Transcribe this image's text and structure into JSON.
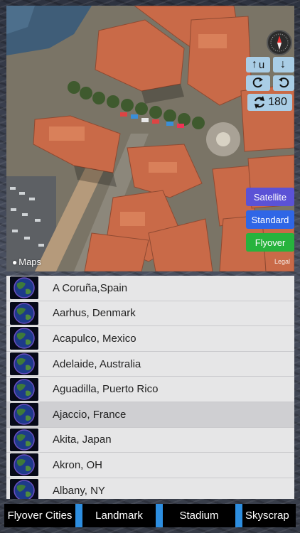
{
  "map": {
    "logo_text": "Maps",
    "legal_text": "Legal",
    "compass_icon": "compass-icon",
    "controls": {
      "tilt_up_label": "u",
      "tilt_down_label": "",
      "rotate_left_icon": "rotate-left-icon",
      "rotate_right_icon": "rotate-right-icon",
      "rotate_value": "180"
    },
    "view_buttons": {
      "satellite": "Satellite",
      "standard": "Standard",
      "flyover": "Flyover"
    },
    "colors": {
      "satellite": "#5b52d6",
      "standard": "#2f66e6",
      "flyover": "#27b33d",
      "control_bg": "#a9cde6"
    }
  },
  "cities": [
    {
      "name": "A Coruña,Spain",
      "selected": false
    },
    {
      "name": "Aarhus, Denmark",
      "selected": false
    },
    {
      "name": "Acapulco, Mexico",
      "selected": false
    },
    {
      "name": "Adelaide, Australia",
      "selected": false
    },
    {
      "name": "Aguadilla, Puerto Rico",
      "selected": false
    },
    {
      "name": "Ajaccio, France",
      "selected": true
    },
    {
      "name": "Akita, Japan",
      "selected": false
    },
    {
      "name": "Akron, OH",
      "selected": false
    },
    {
      "name": "Albany, NY",
      "selected": false
    }
  ],
  "tabs": [
    {
      "label": "Flyover Cities"
    },
    {
      "label": "Landmark"
    },
    {
      "label": "Stadium"
    },
    {
      "label": "Skyscrap"
    }
  ],
  "accent_color": "#2d8ee0"
}
